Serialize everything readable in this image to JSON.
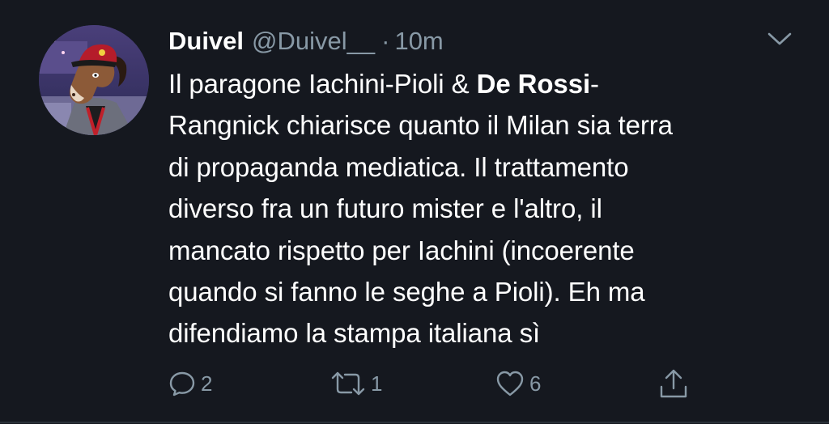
{
  "tweet": {
    "author": {
      "name": "Duivel",
      "handle": "@Duivel__",
      "time_separator": "·",
      "time": "10m",
      "avatar_icon": "bojack-horseman-avatar-icon"
    },
    "body": {
      "line1_pre": "Il paragone Iachini-Pioli & ",
      "line1_bold": "De Rossi",
      "line1_post": "-",
      "line2": "Rangnick chiarisce quanto il Milan sia terra",
      "line3": "di propaganda mediatica. Il trattamento",
      "line4": "diverso fra un futuro mister e l'altro, il",
      "line5": "mancato rispetto per Iachini (incoerente",
      "line6": "quando si fanno le seghe a Pioli). Eh ma",
      "line7": "difendiamo la stampa italiana sì"
    },
    "actions": {
      "reply_count": "2",
      "retweet_count": "1",
      "like_count": "6",
      "reply_icon": "reply-bubble-icon",
      "retweet_icon": "retweet-icon",
      "like_icon": "heart-icon",
      "share_icon": "share-icon",
      "menu_icon": "chevron-down-icon"
    },
    "colors": {
      "background": "#15181f",
      "text": "#ffffff",
      "secondary": "#8899a6"
    }
  }
}
